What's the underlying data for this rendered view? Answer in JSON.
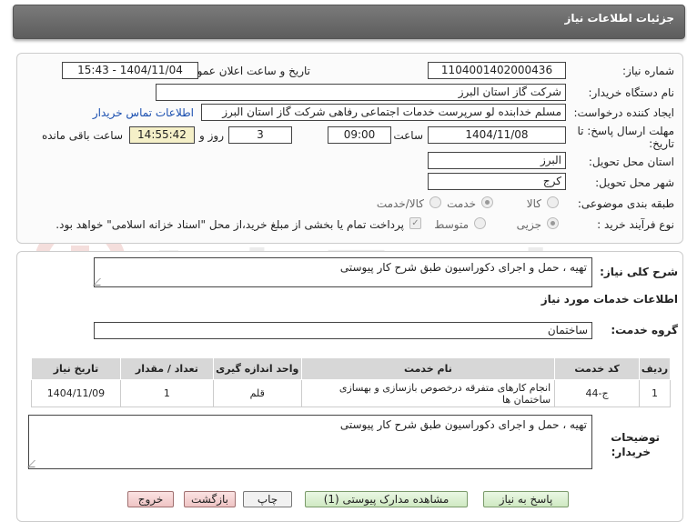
{
  "header": {
    "title": "جزئیات اطلاعات نیاز"
  },
  "form": {
    "need_number_label": "شماره نیاز:",
    "need_number": "1104001402000436",
    "announce_label": "تاریخ و ساعت اعلان عمومی:",
    "announce_value": "1404/11/04 - 15:43",
    "buyer_org_label": "نام دستگاه خریدار:",
    "buyer_org": "شرکت گاز استان البرز",
    "creator_label": "ایجاد کننده درخواست:",
    "creator": "مسلم خدابنده لو سرپرست خدمات اجتماعی رفاهی شرکت گاز استان البرز",
    "contact_link": "اطلاعات تماس خریدار",
    "deadline_label_1": "مهلت ارسال پاسخ: تا",
    "deadline_label_2": "تاریخ:",
    "deadline_date": "1404/11/08",
    "time_label": "ساعت",
    "deadline_time": "09:00",
    "days_value": "3",
    "days_label": "روز و",
    "remaining_time": "14:55:42",
    "remaining_label": "ساعت باقی مانده",
    "province_label": "استان محل تحویل:",
    "province": "البرز",
    "city_label": "شهر محل تحویل:",
    "city": "کرج",
    "category_label": "طبقه بندی موضوعی:",
    "category_options": [
      "کالا",
      "خدمت",
      "کالا/خدمت"
    ],
    "process_label": "نوع فرآیند خرید :",
    "process_options": [
      "جزیی",
      "متوسط"
    ],
    "payment_note": "پرداخت تمام یا بخشی از مبلغ خرید،از محل \"اسناد خزانه اسلامی\" خواهد بود."
  },
  "summary": {
    "label": "شرح کلی نیاز:",
    "text": "تهیه ، حمل و اجرای دکوراسیون طبق شرح کار پیوستی"
  },
  "services": {
    "title": "اطلاعات خدمات مورد نیاز",
    "group_label": "گروه خدمت:",
    "group_value": "ساختمان",
    "columns": [
      "ردیف",
      "کد خدمت",
      "نام خدمت",
      "واحد اندازه گیری",
      "تعداد / مقدار",
      "تاریخ نیاز"
    ],
    "rows": [
      [
        "1",
        "ج-44",
        "انجام کارهای متفرقه درخصوص بازسازی و بهسازی ساختمان ها",
        "قلم",
        "1",
        "1404/11/09"
      ]
    ]
  },
  "buyer_notes": {
    "label_1": "توضیحات",
    "label_2": "خریدار:",
    "text": "تهیه ، حمل و اجرای دکوراسیون طبق شرح کار پیوستی"
  },
  "buttons": {
    "reply": "پاسخ به نیاز",
    "attachments": "مشاهده مدارک پیوستی (1)",
    "print": "چاپ",
    "back": "بازگشت",
    "exit": "خروج"
  },
  "watermark": {
    "text": "AriaTender.net"
  }
}
